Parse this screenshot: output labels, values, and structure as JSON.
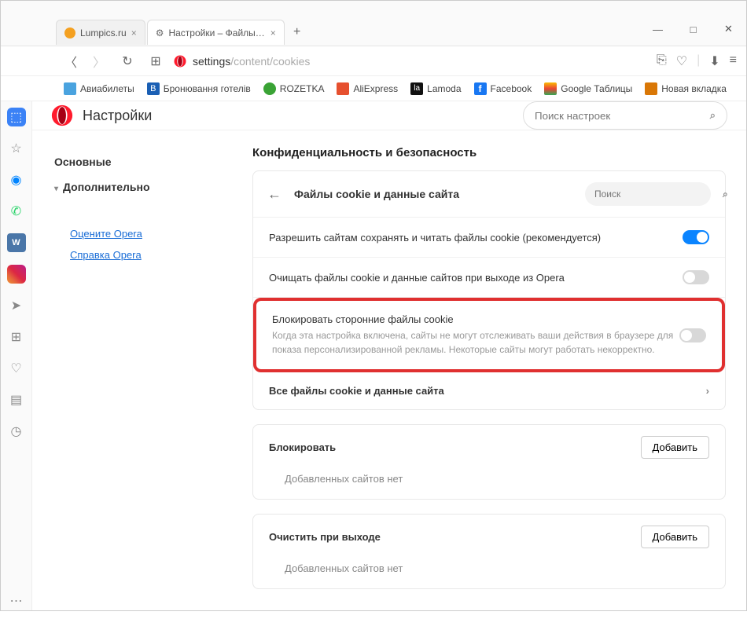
{
  "window": {
    "min": "—",
    "max": "□",
    "close": "✕"
  },
  "tabs": [
    {
      "title": "Lumpics.ru",
      "favicon": "favicon-l"
    },
    {
      "title": "Настройки – Файлы cookie",
      "favicon": "favicon-gear"
    }
  ],
  "url": {
    "prefix": "settings",
    "path": "/content/cookies"
  },
  "bookmarks": [
    {
      "label": "Авиабилеты",
      "color": "#4aa3df"
    },
    {
      "label": "Бронювання готелів",
      "color": "#1a5fb4"
    },
    {
      "label": "ROZETKA",
      "color": "#3aa335"
    },
    {
      "label": "AliExpress",
      "color": "#e6502f"
    },
    {
      "label": "Lamoda",
      "color": "#111"
    },
    {
      "label": "Facebook",
      "color": "#1877f2"
    },
    {
      "label": "Google Таблицы",
      "color": "#fbbc04"
    },
    {
      "label": "Новая вкладка",
      "color": "#d97706"
    }
  ],
  "settings": {
    "title": "Настройки",
    "search_placeholder": "Поиск настроек",
    "nav": {
      "basic": "Основные",
      "advanced": "Дополнительно"
    },
    "links": {
      "rate": "Оцените Opera",
      "help": "Справка Opera"
    },
    "section_title": "Конфиденциальность и безопасность",
    "card_title": "Файлы cookie и данные сайта",
    "mini_search_placeholder": "Поиск",
    "rows": {
      "allow": "Разрешить сайтам сохранять и читать файлы cookie (рекомендуется)",
      "clear_exit": "Очищать файлы cookie и данные сайтов при выходе из Opera",
      "block_title": "Блокировать сторонние файлы cookie",
      "block_desc": "Когда эта настройка включена, сайты не могут отслеживать ваши действия в браузере для показа персонализированной рекламы. Некоторые сайты могут работать некорректно.",
      "all_cookies": "Все файлы cookie и данные сайта"
    },
    "blocklist": {
      "title": "Блокировать",
      "add": "Добавить",
      "empty": "Добавленных сайтов нет"
    },
    "clearlist": {
      "title": "Очистить при выходе",
      "add": "Добавить",
      "empty": "Добавленных сайтов нет"
    }
  }
}
